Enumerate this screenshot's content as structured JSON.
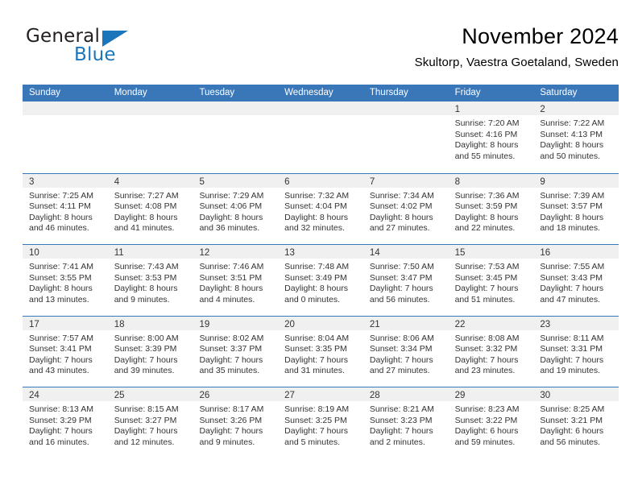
{
  "brand": {
    "word1": "General",
    "word2": "Blue",
    "logo_icon": "triangle-logo-icon",
    "accent_color": "#1b75bb"
  },
  "header": {
    "title": "November 2024",
    "subtitle": "Skultorp, Vaestra Goetaland, Sweden"
  },
  "calendar": {
    "header_bg": "#3a77b9",
    "day_band_bg": "#f0f0f0",
    "weekday_headers": [
      "Sunday",
      "Monday",
      "Tuesday",
      "Wednesday",
      "Thursday",
      "Friday",
      "Saturday"
    ],
    "weeks": [
      [
        {
          "day": "",
          "lines": []
        },
        {
          "day": "",
          "lines": []
        },
        {
          "day": "",
          "lines": []
        },
        {
          "day": "",
          "lines": []
        },
        {
          "day": "",
          "lines": []
        },
        {
          "day": "1",
          "lines": [
            "Sunrise: 7:20 AM",
            "Sunset: 4:16 PM",
            "Daylight: 8 hours",
            "and 55 minutes."
          ]
        },
        {
          "day": "2",
          "lines": [
            "Sunrise: 7:22 AM",
            "Sunset: 4:13 PM",
            "Daylight: 8 hours",
            "and 50 minutes."
          ]
        }
      ],
      [
        {
          "day": "3",
          "lines": [
            "Sunrise: 7:25 AM",
            "Sunset: 4:11 PM",
            "Daylight: 8 hours",
            "and 46 minutes."
          ]
        },
        {
          "day": "4",
          "lines": [
            "Sunrise: 7:27 AM",
            "Sunset: 4:08 PM",
            "Daylight: 8 hours",
            "and 41 minutes."
          ]
        },
        {
          "day": "5",
          "lines": [
            "Sunrise: 7:29 AM",
            "Sunset: 4:06 PM",
            "Daylight: 8 hours",
            "and 36 minutes."
          ]
        },
        {
          "day": "6",
          "lines": [
            "Sunrise: 7:32 AM",
            "Sunset: 4:04 PM",
            "Daylight: 8 hours",
            "and 32 minutes."
          ]
        },
        {
          "day": "7",
          "lines": [
            "Sunrise: 7:34 AM",
            "Sunset: 4:02 PM",
            "Daylight: 8 hours",
            "and 27 minutes."
          ]
        },
        {
          "day": "8",
          "lines": [
            "Sunrise: 7:36 AM",
            "Sunset: 3:59 PM",
            "Daylight: 8 hours",
            "and 22 minutes."
          ]
        },
        {
          "day": "9",
          "lines": [
            "Sunrise: 7:39 AM",
            "Sunset: 3:57 PM",
            "Daylight: 8 hours",
            "and 18 minutes."
          ]
        }
      ],
      [
        {
          "day": "10",
          "lines": [
            "Sunrise: 7:41 AM",
            "Sunset: 3:55 PM",
            "Daylight: 8 hours",
            "and 13 minutes."
          ]
        },
        {
          "day": "11",
          "lines": [
            "Sunrise: 7:43 AM",
            "Sunset: 3:53 PM",
            "Daylight: 8 hours",
            "and 9 minutes."
          ]
        },
        {
          "day": "12",
          "lines": [
            "Sunrise: 7:46 AM",
            "Sunset: 3:51 PM",
            "Daylight: 8 hours",
            "and 4 minutes."
          ]
        },
        {
          "day": "13",
          "lines": [
            "Sunrise: 7:48 AM",
            "Sunset: 3:49 PM",
            "Daylight: 8 hours",
            "and 0 minutes."
          ]
        },
        {
          "day": "14",
          "lines": [
            "Sunrise: 7:50 AM",
            "Sunset: 3:47 PM",
            "Daylight: 7 hours",
            "and 56 minutes."
          ]
        },
        {
          "day": "15",
          "lines": [
            "Sunrise: 7:53 AM",
            "Sunset: 3:45 PM",
            "Daylight: 7 hours",
            "and 51 minutes."
          ]
        },
        {
          "day": "16",
          "lines": [
            "Sunrise: 7:55 AM",
            "Sunset: 3:43 PM",
            "Daylight: 7 hours",
            "and 47 minutes."
          ]
        }
      ],
      [
        {
          "day": "17",
          "lines": [
            "Sunrise: 7:57 AM",
            "Sunset: 3:41 PM",
            "Daylight: 7 hours",
            "and 43 minutes."
          ]
        },
        {
          "day": "18",
          "lines": [
            "Sunrise: 8:00 AM",
            "Sunset: 3:39 PM",
            "Daylight: 7 hours",
            "and 39 minutes."
          ]
        },
        {
          "day": "19",
          "lines": [
            "Sunrise: 8:02 AM",
            "Sunset: 3:37 PM",
            "Daylight: 7 hours",
            "and 35 minutes."
          ]
        },
        {
          "day": "20",
          "lines": [
            "Sunrise: 8:04 AM",
            "Sunset: 3:35 PM",
            "Daylight: 7 hours",
            "and 31 minutes."
          ]
        },
        {
          "day": "21",
          "lines": [
            "Sunrise: 8:06 AM",
            "Sunset: 3:34 PM",
            "Daylight: 7 hours",
            "and 27 minutes."
          ]
        },
        {
          "day": "22",
          "lines": [
            "Sunrise: 8:08 AM",
            "Sunset: 3:32 PM",
            "Daylight: 7 hours",
            "and 23 minutes."
          ]
        },
        {
          "day": "23",
          "lines": [
            "Sunrise: 8:11 AM",
            "Sunset: 3:31 PM",
            "Daylight: 7 hours",
            "and 19 minutes."
          ]
        }
      ],
      [
        {
          "day": "24",
          "lines": [
            "Sunrise: 8:13 AM",
            "Sunset: 3:29 PM",
            "Daylight: 7 hours",
            "and 16 minutes."
          ]
        },
        {
          "day": "25",
          "lines": [
            "Sunrise: 8:15 AM",
            "Sunset: 3:27 PM",
            "Daylight: 7 hours",
            "and 12 minutes."
          ]
        },
        {
          "day": "26",
          "lines": [
            "Sunrise: 8:17 AM",
            "Sunset: 3:26 PM",
            "Daylight: 7 hours",
            "and 9 minutes."
          ]
        },
        {
          "day": "27",
          "lines": [
            "Sunrise: 8:19 AM",
            "Sunset: 3:25 PM",
            "Daylight: 7 hours",
            "and 5 minutes."
          ]
        },
        {
          "day": "28",
          "lines": [
            "Sunrise: 8:21 AM",
            "Sunset: 3:23 PM",
            "Daylight: 7 hours",
            "and 2 minutes."
          ]
        },
        {
          "day": "29",
          "lines": [
            "Sunrise: 8:23 AM",
            "Sunset: 3:22 PM",
            "Daylight: 6 hours",
            "and 59 minutes."
          ]
        },
        {
          "day": "30",
          "lines": [
            "Sunrise: 8:25 AM",
            "Sunset: 3:21 PM",
            "Daylight: 6 hours",
            "and 56 minutes."
          ]
        }
      ]
    ]
  }
}
